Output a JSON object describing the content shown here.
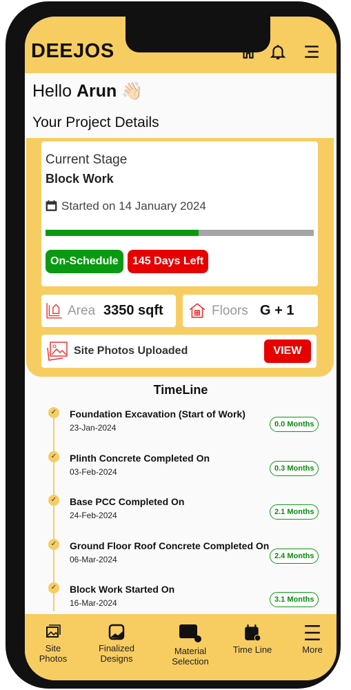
{
  "header": {
    "logo": "DEEJOS",
    "icons": [
      "home-icon",
      "bell-icon",
      "menu-icon"
    ]
  },
  "greeting": {
    "hello": "Hello",
    "name": "Arun",
    "emoji": "👋🏻"
  },
  "section_title": "Your Project Details",
  "stage": {
    "label": "Current Stage",
    "value": "Block Work",
    "started": "Started on 14 January 2024",
    "progress_percent": 57,
    "status": "On-Schedule",
    "days_left": "145 Days Left"
  },
  "colors": {
    "accent": "#f7cd62",
    "green": "#0a9a12",
    "red": "#e60000"
  },
  "area": {
    "label": "Area",
    "value": "3350 sqft"
  },
  "floors": {
    "label": "Floors",
    "value": "G + 1"
  },
  "photos": {
    "label": "Site Photos Uploaded",
    "button": "VIEW"
  },
  "timeline": {
    "title": "TimeLine",
    "items": [
      {
        "title": "Foundation Excavation (Start of Work)",
        "date": "23-Jan-2024",
        "months": "0.0 Months"
      },
      {
        "title": "Plinth Concrete Completed On",
        "date": "03-Feb-2024",
        "months": "0.3 Months"
      },
      {
        "title": "Base PCC Completed On",
        "date": "24-Feb-2024",
        "months": "2.1 Months"
      },
      {
        "title": "Ground Floor Roof Concrete Completed On",
        "date": "06-Mar-2024",
        "months": "2.4 Months"
      },
      {
        "title": "Block Work Started On",
        "date": "16-Mar-2024",
        "months": "3.1 Months"
      }
    ]
  },
  "nav": {
    "site_photos": "Site Photos",
    "finalized": "Finalized Designs",
    "material": "Material Selection",
    "timeline": "Time Line",
    "more": "More"
  }
}
